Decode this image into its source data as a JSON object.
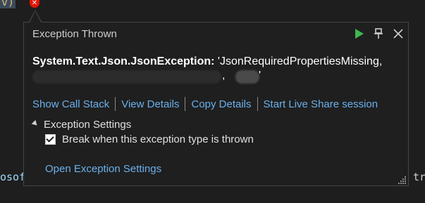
{
  "editor": {
    "code_top": "v)",
    "code_left": "osof",
    "code_right": "tra"
  },
  "popup": {
    "title": "Exception Thrown",
    "controls": {
      "continue_icon": "play-icon",
      "pin_icon": "pin-icon",
      "close_icon": "close-icon"
    },
    "exception_type": "System.Text.Json.JsonException:",
    "exception_message": "'JsonRequiredPropertiesMissing,",
    "exception_message_end": "'",
    "links": [
      "Show Call Stack",
      "View Details",
      "Copy Details",
      "Start Live Share session"
    ],
    "settings_header": "Exception Settings",
    "break_checkbox": {
      "label": "Break when this exception type is thrown",
      "checked": true
    },
    "open_settings_link": "Open Exception Settings"
  },
  "colors": {
    "background": "#1e1e1e",
    "popup_bg": "#1f1f1f",
    "link": "#6ab0ec",
    "play": "#3fb950",
    "error": "#e51400"
  }
}
